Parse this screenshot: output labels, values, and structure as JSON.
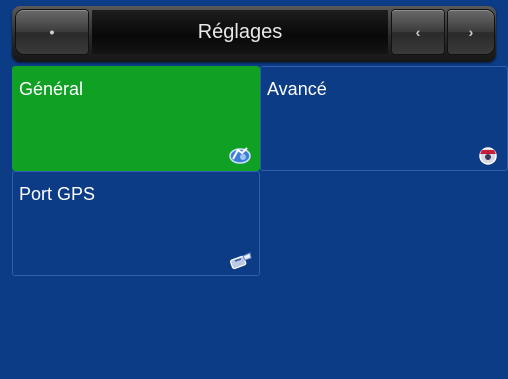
{
  "title_bar": {
    "title": "Réglages",
    "back_glyph": "•",
    "prev_glyph": "‹",
    "next_glyph": "›"
  },
  "tiles": [
    {
      "label": "Général",
      "icon": "settings-general-icon",
      "selected": true
    },
    {
      "label": "Avancé",
      "icon": "settings-advanced-icon",
      "selected": false
    },
    {
      "label": "Port GPS",
      "icon": "gps-port-icon",
      "selected": false
    }
  ],
  "colors": {
    "background": "#0c3c86",
    "selected_tile": "#0fa024",
    "title_bar": "#2a2a2a",
    "text": "#ffffff"
  }
}
